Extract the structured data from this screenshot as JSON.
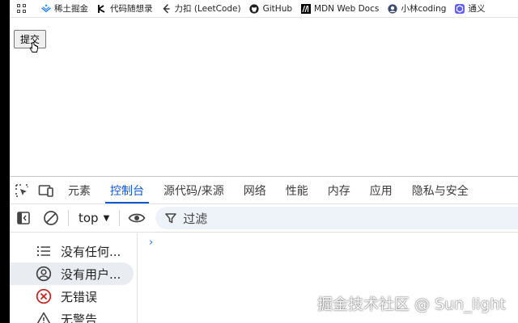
{
  "bookmarks": [
    {
      "label": "稀土掘金",
      "icon": "juejin-icon",
      "color": "#1e80ff"
    },
    {
      "label": "代码随想录",
      "icon": "code-icon",
      "color": "#000000"
    },
    {
      "label": "力扣 (LeetCode)",
      "icon": "leetcode-icon",
      "color": "#1f1f1f"
    },
    {
      "label": "GitHub",
      "icon": "github-icon",
      "color": "#1f1f1f"
    },
    {
      "label": "MDN Web Docs",
      "icon": "mdn-icon",
      "color": "#000000"
    },
    {
      "label": "小林coding",
      "icon": "xiaolin-icon",
      "color": "#3c4a6b"
    },
    {
      "label": "通义",
      "icon": "tongyi-icon",
      "color": "#615ced"
    }
  ],
  "page": {
    "submit_label": "提交"
  },
  "devtools": {
    "tabs": [
      {
        "label": "元素",
        "active": false
      },
      {
        "label": "控制台",
        "active": true
      },
      {
        "label": "源代码/来源",
        "active": false
      },
      {
        "label": "网络",
        "active": false
      },
      {
        "label": "性能",
        "active": false
      },
      {
        "label": "内存",
        "active": false
      },
      {
        "label": "应用",
        "active": false
      },
      {
        "label": "隐私与安全",
        "active": false
      }
    ],
    "context": "top",
    "filter_placeholder": "过滤",
    "sidebar": [
      {
        "label": "没有任何...",
        "icon": "list-icon",
        "selected": false
      },
      {
        "label": "没有用户...",
        "icon": "user-icon",
        "selected": true
      },
      {
        "label": "无错误",
        "icon": "error-icon",
        "selected": false
      },
      {
        "label": "无警告",
        "icon": "warning-icon",
        "selected": false
      }
    ],
    "accent_color": "#0b57d0"
  },
  "watermark": "掘金技术社区 @ Sun_light"
}
